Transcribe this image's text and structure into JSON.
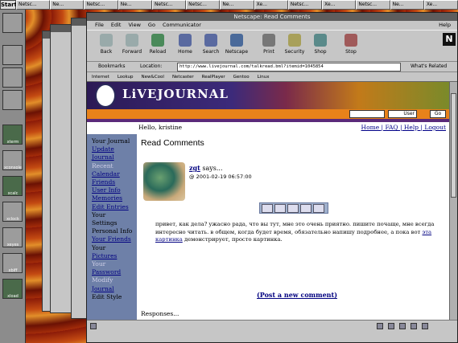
{
  "taskbar": {
    "start": "Start",
    "tasks": [
      "Netsc...",
      "Ne...",
      "Netsc...",
      "Ne...",
      "Netsc...",
      "Netsc...",
      "Ne...",
      "Xe...",
      "Netsc...",
      "Xe...",
      "Netsc...",
      "Ne...",
      "Xe..."
    ]
  },
  "dock": {
    "items": [
      "xterm",
      "xconsole",
      "xcalc",
      "xclock",
      "xeyes",
      "xbiff",
      "xload"
    ]
  },
  "window": {
    "title": "Netscape: Read Comments"
  },
  "menubar": {
    "items": [
      "File",
      "Edit",
      "View",
      "Go",
      "Communicator"
    ],
    "help": "Help"
  },
  "toolbar": {
    "buttons": [
      "Back",
      "Forward",
      "Reload",
      "Home",
      "Search",
      "Netscape",
      "Print",
      "Security",
      "Shop",
      "Stop"
    ]
  },
  "location": {
    "bookmarks_label": "Bookmarks",
    "location_label": "Location:",
    "url": "http://www.livejournal.com/talkread.bml?itemid=1045854",
    "related_label": "What's Related"
  },
  "personal_toolbar": {
    "items": [
      "Internet",
      "Lookup",
      "New&Cool",
      "Netcaster",
      "RealPlayer",
      "Gentoo",
      "Linux"
    ]
  },
  "lj": {
    "logo_text": "LiVEJOURNAL",
    "search_option": "User",
    "search_go": "Go",
    "hello": "Hello, kristine",
    "top_links": "Home | FAQ | Help | Logout"
  },
  "sidebar": {
    "items": [
      {
        "text": "Your Journal",
        "style": "hdr"
      },
      {
        "text": "Update",
        "style": "lnk"
      },
      {
        "text": "Journal",
        "style": "lnk"
      },
      {
        "text": "Recent",
        "style": "dim"
      },
      {
        "text": "Calendar",
        "style": "lnk"
      },
      {
        "text": "Friends",
        "style": "lnk"
      },
      {
        "text": "User Info",
        "style": "lnk"
      },
      {
        "text": "Memories",
        "style": "lnk"
      },
      {
        "text": "Edit Entries",
        "style": "lnk"
      },
      {
        "text": "Your",
        "style": "hdr"
      },
      {
        "text": "Settings",
        "style": "hdr"
      },
      {
        "text": "Personal Info",
        "style": "hdr"
      },
      {
        "text": "Your Friends",
        "style": "lnk"
      },
      {
        "text": "Your",
        "style": "hdr"
      },
      {
        "text": "Pictures",
        "style": "lnk"
      },
      {
        "text": "Your",
        "style": "dim"
      },
      {
        "text": "Password",
        "style": "lnk"
      },
      {
        "text": "Modify",
        "style": "dim"
      },
      {
        "text": "Journal",
        "style": "lnk"
      },
      {
        "text": "Edit Style",
        "style": "hdr"
      }
    ]
  },
  "comments": {
    "heading": "Read Comments",
    "author": "zgt",
    "says": " says...",
    "date": "@ 2001-02-19 06:57:00",
    "body_1": "привет, как дела? ужасно рада, что вы тут, мне это очень приятно. пишите почаще, мне всегда интересно читать. в общем, когда будет время, обязательно напишу подробнее, а пока вот",
    "link_text": "эта картинка",
    "body_2": " демонстрирует, просто картинка.",
    "post_new": "(Post a new comment)",
    "responses": "Responses..."
  }
}
